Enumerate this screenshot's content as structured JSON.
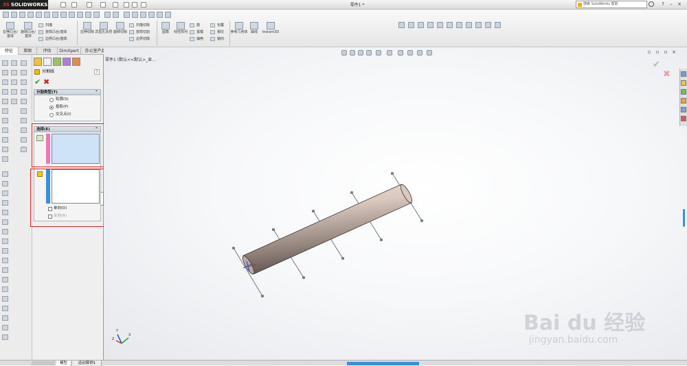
{
  "titlebar": {
    "logo_text": "SOLIDWORKS",
    "doc_title": "零件1 *",
    "search_placeholder": "搜索 SolidWorks 帮助"
  },
  "command_manager": {
    "features_big": [
      {
        "label": "拉伸凸台/基体"
      },
      {
        "label": "旋转凸台/基体"
      }
    ],
    "features_small": [
      "扫描",
      "放样凸台/基体",
      "边界凸台/基体"
    ],
    "cuts_big": [
      {
        "label": "拉伸切除"
      },
      {
        "label": "异型孔向导"
      },
      {
        "label": "旋转切除"
      }
    ],
    "cuts_small": [
      "扫描切除",
      "放样切割",
      "边界切除"
    ],
    "fillet": "圆角",
    "pattern": "线性阵列",
    "misc_small": [
      "筋",
      "拔模",
      "抽壳",
      "包覆",
      "相交",
      "镜向"
    ],
    "refgeom": "参考几何体",
    "curves": "曲线",
    "instant3d": "Instant3D"
  },
  "tabs": [
    "特征",
    "草图",
    "评估",
    "DimXpert",
    "办公室产品"
  ],
  "property_manager": {
    "title": "分割线",
    "help": "?",
    "ok": "✔",
    "cancel": "✖",
    "group_type": {
      "header": "分割类型(T)",
      "options": [
        "轮廓(S)",
        "投影(P)",
        "交叉点(I)"
      ],
      "selected": 1
    },
    "group_select": {
      "header": "选择(E)",
      "single_direction": "单向(D)",
      "reverse_direction": "反向(R)"
    }
  },
  "viewport": {
    "tree_label": "零件1 (默认<<默认>_显..."
  },
  "triad": {
    "x": "X",
    "y": "Y",
    "z": "Z"
  },
  "bottom_tabs": [
    "模型",
    "运动算例1"
  ],
  "watermark": {
    "brand": "Bai du 经验",
    "url": "jingyan.baidu.com"
  },
  "colors": {
    "ok": "#2b9b2b",
    "cancel": "#c82020",
    "highlight": "#e02020",
    "selection_bar_pink": "#e87ab8",
    "selection_bar_blue": "#3a8fd8"
  }
}
